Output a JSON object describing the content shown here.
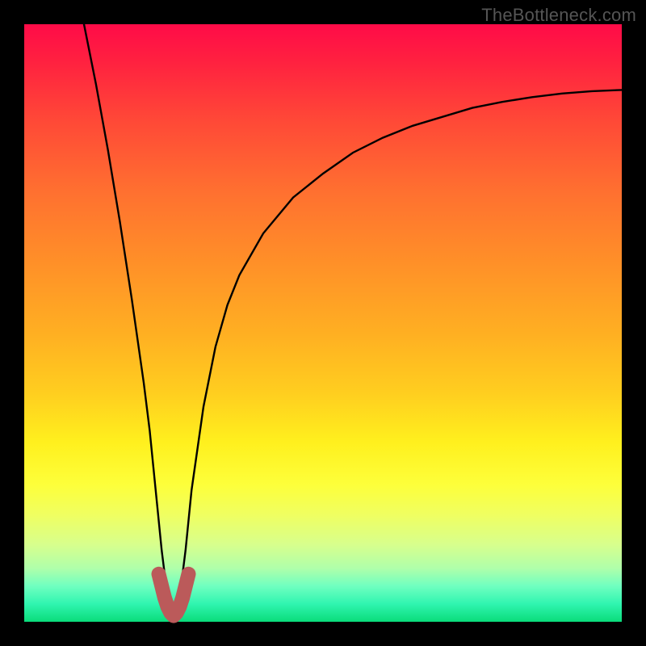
{
  "watermark": "TheBottleneck.com",
  "chart_data": {
    "type": "line",
    "title": "",
    "xlabel": "",
    "ylabel": "",
    "xlim": [
      0,
      100
    ],
    "ylim": [
      0,
      100
    ],
    "grid": false,
    "series": [
      {
        "name": "bottleneck-curve",
        "color": "#000000",
        "x": [
          10,
          12,
          14,
          16,
          18,
          20,
          21,
          22,
          23,
          24,
          25,
          26,
          27,
          28,
          30,
          32,
          34,
          36,
          40,
          45,
          50,
          55,
          60,
          65,
          70,
          75,
          80,
          85,
          90,
          95,
          100
        ],
        "y": [
          100,
          90,
          79,
          67,
          54,
          40,
          32,
          22,
          12,
          4,
          1,
          4,
          12,
          22,
          36,
          46,
          53,
          58,
          65,
          71,
          75,
          78.5,
          81,
          83,
          84.5,
          86,
          87,
          87.8,
          88.4,
          88.8,
          89
        ]
      },
      {
        "name": "highlight-dip",
        "color": "#bb5a5a",
        "x": [
          22.5,
          23,
          23.5,
          24,
          24.5,
          25,
          25.5,
          26,
          26.5,
          27,
          27.5
        ],
        "y": [
          8,
          6,
          4,
          2.5,
          1.5,
          1,
          1.5,
          2.5,
          4,
          6,
          8
        ]
      }
    ],
    "annotations": []
  }
}
